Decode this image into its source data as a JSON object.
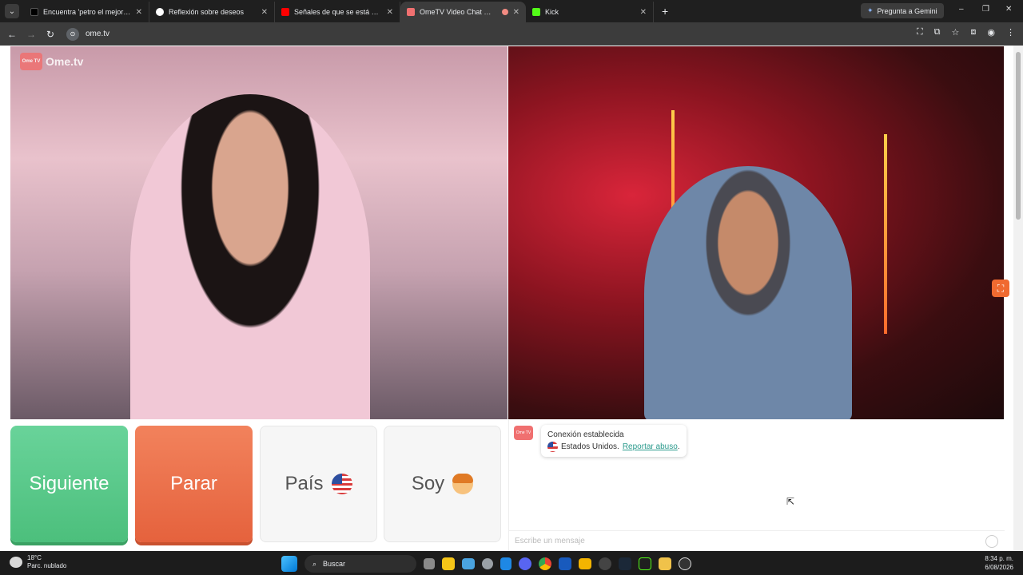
{
  "browser": {
    "tabs": [
      {
        "label": "Encuentra 'petro el mejor presi",
        "favicon_color": "#000000",
        "active": false
      },
      {
        "label": "Reflexión sobre deseos",
        "favicon_color": "#ffffff",
        "active": false
      },
      {
        "label": "Señales de que se está ponienc",
        "favicon_color": "#ff0000",
        "active": false
      },
      {
        "label": "OmeTV Video Chat — Ome",
        "favicon_color": "#f07070",
        "active": true
      },
      {
        "label": "Kick",
        "favicon_color": "#53fc18",
        "active": false
      }
    ],
    "tab_close": "✕",
    "new_tab": "+",
    "gemini_label": "Pregunta a Gemini",
    "window_controls": {
      "minimize": "–",
      "maximize": "❐",
      "close": "✕"
    },
    "url": "ome.tv",
    "nav": {
      "back": "←",
      "forward": "→",
      "reload": "↻"
    }
  },
  "page": {
    "logo_text": "Ome.tv",
    "logo_badge": "Ome TV",
    "buttons": {
      "next": "Siguiente",
      "stop": "Parar",
      "country": "País",
      "soy": "Soy"
    },
    "chat": {
      "status": "Conexión establecida",
      "country_text": "Estados Unidos.",
      "report_link": "Reportar abuso",
      "report_suffix": ".",
      "input_placeholder": "Escribe un mensaje"
    },
    "colors": {
      "next": "#4cbf7c",
      "stop": "#e5623d",
      "accent_link": "#2a9a8c"
    }
  },
  "taskbar": {
    "temperature": "18°C",
    "weather": "Parc. nublado",
    "search_label": "Buscar",
    "time": "8:34 p. m.",
    "date": "6/08/2026",
    "pinned_apps": [
      "start-icon",
      "search-icon",
      "widgets-icon",
      "task-view-icon",
      "store-icon",
      "mail-icon",
      "settings-icon",
      "security-icon",
      "discord-icon",
      "chrome-icon",
      "word-icon",
      "explorer-icon",
      "obs-icon",
      "steam-icon",
      "kick-icon",
      "notes-icon",
      "media-icon"
    ]
  }
}
